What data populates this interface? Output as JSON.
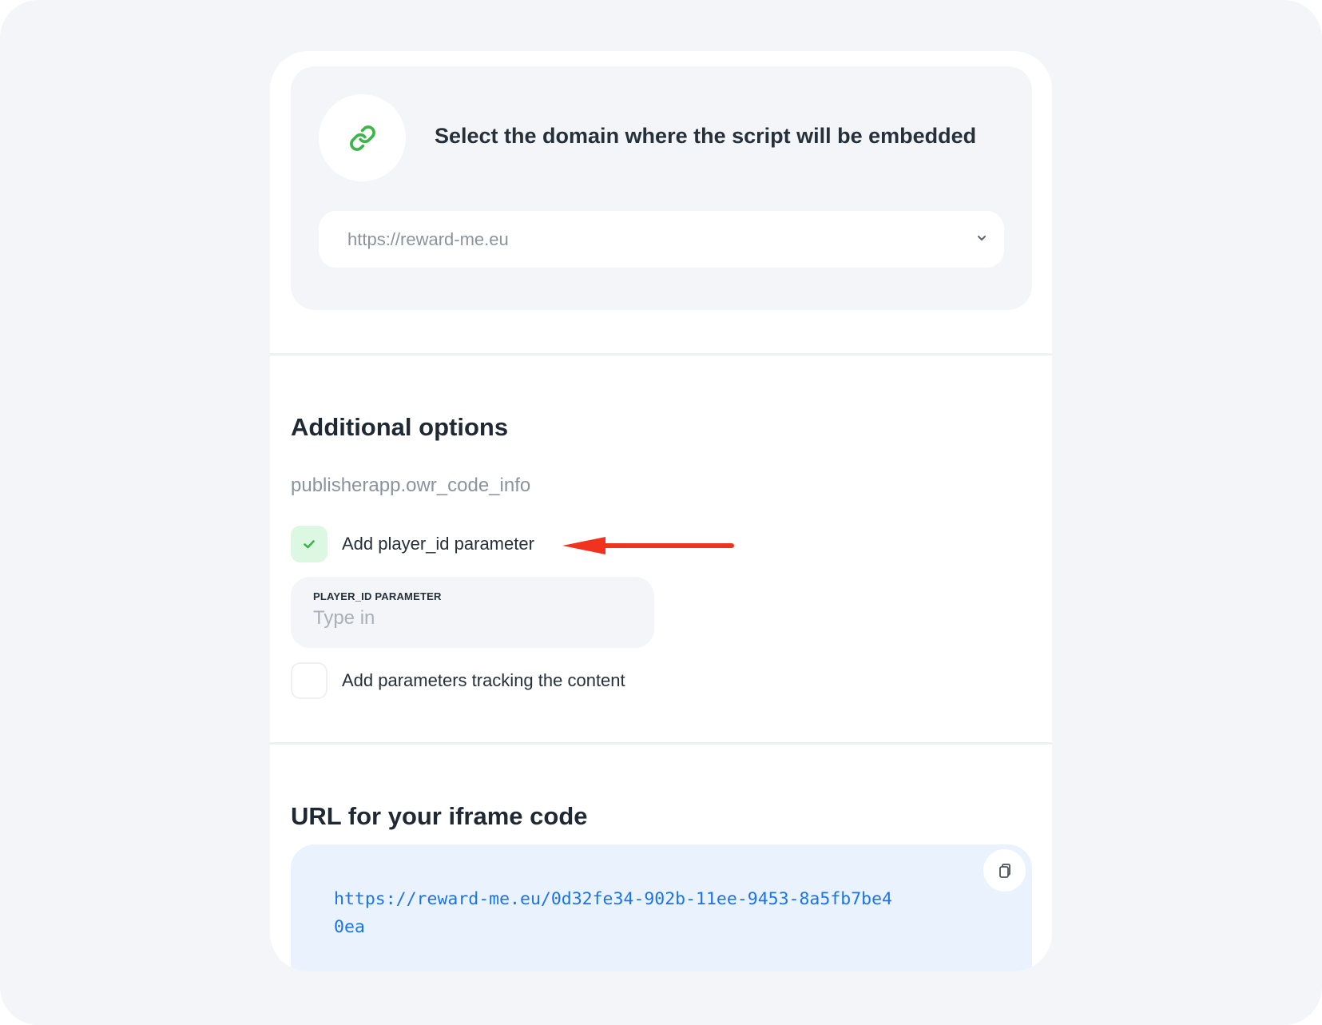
{
  "domain_section": {
    "title": "Select the domain where the script will be embedded",
    "link_icon": "link-icon",
    "select": {
      "value": "https://reward-me.eu",
      "chevron_icon": "chevron-down-icon"
    }
  },
  "options_section": {
    "title": "Additional options",
    "info": "publisherapp.owr_code_info",
    "player_id_checkbox": {
      "label": "Add player_id parameter",
      "checked": true
    },
    "player_id_field": {
      "label": "PLAYER_ID PARAMETER",
      "placeholder": "Type in",
      "value": ""
    },
    "tracking_checkbox": {
      "label": "Add parameters tracking the content",
      "checked": false
    },
    "annotation_arrow": "arrow-left-icon"
  },
  "url_section": {
    "title": "URL for your iframe code",
    "code": "https://reward-me.eu/0d32fe34-902b-11ee-9453-8a5fb7be40ea",
    "copy_icon": "copy-icon"
  },
  "colors": {
    "page_background": "#f4f5f8",
    "card": "#ffffff",
    "accent_green": "#3cb54a",
    "checkbox_checked_bg": "#dcf7e2",
    "code_background": "#eaf3fd",
    "code_text": "#1a73e8",
    "annotation_red": "#f0321e"
  }
}
